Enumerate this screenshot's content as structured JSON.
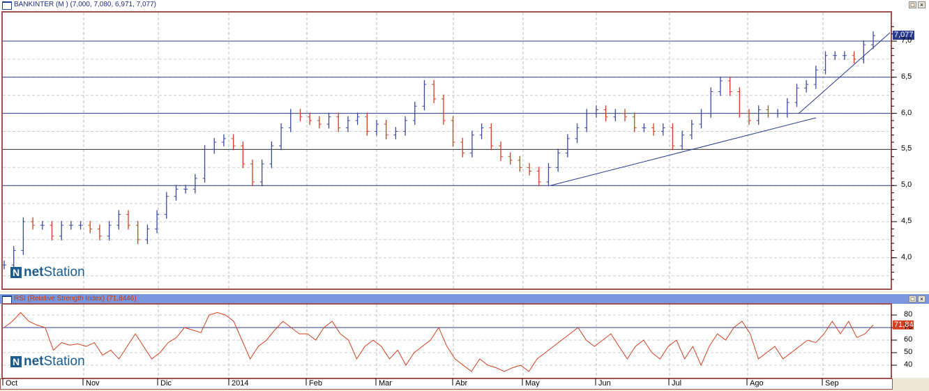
{
  "price_panel": {
    "title": "BANKINTER (M ) (7,000, 7,080, 6,971, 7,077)",
    "last_value": "7,077",
    "y_ticks": [
      "7,0",
      "6,5",
      "6,0",
      "5,5",
      "5,0",
      "4,5",
      "4,0"
    ],
    "y_values": [
      7.0,
      6.5,
      6.0,
      5.5,
      5.0,
      4.5,
      4.0
    ],
    "h_lines": [
      7.0,
      6.5,
      6.0,
      5.5,
      5.0
    ],
    "closes": [
      3.9,
      4.1,
      4.5,
      4.45,
      4.45,
      4.3,
      4.45,
      4.45,
      4.45,
      4.4,
      4.3,
      4.45,
      4.6,
      4.45,
      4.25,
      4.4,
      4.6,
      4.85,
      4.95,
      4.95,
      5.1,
      5.5,
      5.6,
      5.65,
      5.55,
      5.3,
      5.05,
      5.3,
      5.55,
      5.8,
      6.0,
      5.95,
      5.9,
      5.85,
      5.95,
      5.8,
      5.9,
      5.95,
      5.75,
      5.85,
      5.7,
      5.75,
      5.9,
      6.1,
      6.4,
      6.2,
      5.9,
      5.6,
      5.45,
      5.7,
      5.8,
      5.55,
      5.4,
      5.35,
      5.25,
      5.2,
      5.05,
      5.25,
      5.45,
      5.65,
      5.8,
      6.0,
      6.05,
      5.95,
      6.0,
      5.95,
      5.8,
      5.8,
      5.75,
      5.8,
      5.55,
      5.7,
      5.85,
      6.0,
      6.3,
      6.45,
      6.3,
      6.0,
      5.9,
      6.05,
      6.0,
      6.0,
      6.15,
      6.35,
      6.4,
      6.6,
      6.8,
      6.8,
      6.8,
      6.75,
      6.95,
      7.077
    ],
    "colors": {
      "up": "#3a4aa0",
      "down": "#d04020",
      "line": "#2a3a8f"
    }
  },
  "rsi_panel": {
    "title": "RSI (Relative Strength Index) (71,8446)",
    "last_value": "71,84",
    "y_ticks": [
      "80",
      "70",
      "60",
      "50",
      "40"
    ],
    "y_values": [
      80,
      70,
      60,
      50,
      40
    ],
    "level": 70,
    "values": [
      70,
      75,
      82,
      75,
      72,
      70,
      52,
      58,
      56,
      57,
      55,
      58,
      48,
      52,
      45,
      55,
      65,
      55,
      45,
      50,
      58,
      62,
      70,
      68,
      66,
      80,
      82,
      80,
      75,
      60,
      45,
      55,
      60,
      68,
      75,
      70,
      65,
      65,
      60,
      70,
      75,
      65,
      60,
      45,
      55,
      60,
      55,
      45,
      52,
      40,
      50,
      55,
      60,
      70,
      55,
      45,
      40,
      35,
      45,
      40,
      38,
      35,
      38,
      40,
      35,
      45,
      50,
      55,
      60,
      65,
      70,
      60,
      55,
      60,
      65,
      55,
      45,
      55,
      60,
      50,
      45,
      55,
      60,
      45,
      55,
      40,
      55,
      65,
      60,
      70,
      75,
      65,
      45,
      50,
      55,
      45,
      50,
      55,
      60,
      58,
      65,
      75,
      65,
      75,
      62,
      65,
      72
    ],
    "color": "#d04020"
  },
  "x_axis": {
    "labels": [
      "Oct",
      "Nov",
      "Dic",
      "2014",
      "Feb",
      "Mar",
      "Abr",
      "May",
      "Jun",
      "Jul",
      "Ago",
      "Sep"
    ]
  },
  "logo": {
    "prefix": "net",
    "suffix": "Station"
  },
  "window_buttons": {
    "maximize": "□",
    "close": "×"
  }
}
